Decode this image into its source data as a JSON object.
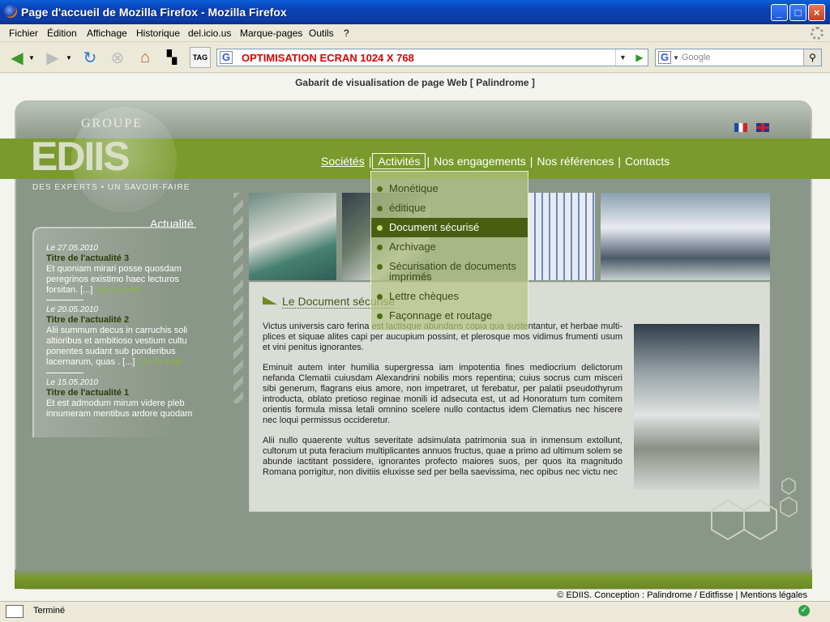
{
  "window": {
    "title": "Page d'accueil de Mozilla Firefox - Mozilla Firefox"
  },
  "menu": [
    "Fichier",
    "Édition",
    "Affichage",
    "Historique",
    "del.icio.us",
    "Marque-pages",
    "Outils",
    "?"
  ],
  "toolbar": {
    "tag_label": "TAG",
    "url": "OPTIMISATION ECRAN 1024 X 768",
    "search_placeholder": "Google"
  },
  "page": {
    "gabarit": "Gabarit de visualisation de page Web [ Palindrome ]",
    "logo": {
      "groupe": "GROUPE",
      "name": "EDIIS",
      "tagline": "DES EXPERTS • UN SAVOIR-FAIRE"
    },
    "nav": [
      "Sociétés",
      "Activités",
      "Nos engagements",
      "Nos références",
      "Contacts"
    ],
    "dropdown": [
      "Monétique",
      "éditique",
      "Document sécurisé",
      "Archivage",
      "Sécurisation de documents imprimés",
      "Lettre chèques",
      "Façonnage et routage"
    ],
    "actualite_title": "Actualité",
    "news": [
      {
        "date": "Le 27.05.2010",
        "title": "Titre de l'actualité 3",
        "text": "Et quoniam mirari posse quosdam peregrinos existimo haec lecturos forsitan. [...]",
        "more": "Lire la suite"
      },
      {
        "date": "Le 20.05.2010",
        "title": "Titre de l'actualité 2",
        "text": "Alii summum decus in carruchis soli altioribus et ambitioso vestium cultu ponentes sudant sub ponderibus lacernarum, quas . [...]",
        "more": "Lire la suite"
      },
      {
        "date": "Le 15.05.2010",
        "title": "Titre de l'actualité 1",
        "text": "Et est admodum mirum videre pleb innumeram mentibus ardore quodam",
        "more": ""
      }
    ],
    "content": {
      "heading": "Le Document sécurisé",
      "p1": "Victus universis caro ferina est lactisque abundans copia qua sustentantur, et herbae multi-plices et siquae alites capi per aucupium possint, et plerosque mos vidimus frumenti usum et vini penitus ignorantes.",
      "p2": "Eminuit autem inter humilia supergressa iam impotentia fines mediocrium delictorum nefanda Clematii cuiusdam Alexandrini nobilis mors repentina; cuius socrus cum misceri sibi generum, flagrans eius amore, non impetraret, ut ferebatur, per palatii pseudothyrum introducta, oblato pretioso reginae monili id adsecuta est, ut ad Honoratum tum comitem orientis formula missa letali omnino scelere nullo contactus idem Clematius nec hiscere nec loqui permissus occideretur.",
      "p3": "Alii nullo quaerente vultus severitate adsimulata patrimonia sua in inmensum extollunt, cultorum ut puta feracium multiplicantes annuos fructus, quae a primo ad ultimum solem se abunde iactitant possidere, ignorantes profecto maiores suos, per quos ita magnitudo Romana porrigitur, non divitiis eluxisse sed per bella saevissima, nec opibus nec victu nec"
    },
    "copyright": "© EDIIS. Conception : Palindrome / Editfisse  |  Mentions légales"
  },
  "status": {
    "text": "Terminé"
  },
  "colors": {
    "accent_green": "#7a9a2e",
    "frame_gray": "#8a9688",
    "title_blue": "#0b3fb3"
  }
}
